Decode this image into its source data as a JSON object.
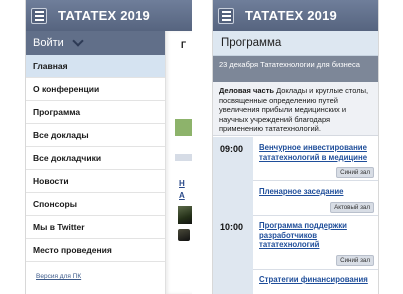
{
  "left": {
    "app_title": "ТАТАТЕХ 2019",
    "login_label": "Войти",
    "menu": [
      "Главная",
      "О конференции",
      "Программа",
      "Все доклады",
      "Все докладчики",
      "Новости",
      "Спонсоры",
      "Мы в Twitter",
      "Место проведения"
    ],
    "pc_link": "Версия для ПК",
    "peek": {
      "letter": "Г",
      "link1": "Н",
      "link2": "А"
    }
  },
  "right": {
    "app_title": "ТАТАТЕХ 2019",
    "section_title": "Программа",
    "date_line": "23 декабря Тататехнологии для бизнеса",
    "plenary_bold": "Деловая часть",
    "plenary_text": " Доклады и круглые столы, посвященные определению путей увеличения прибыли медицинских и научных учреждений благодаря применению тататехнологий.",
    "slots": [
      {
        "time": "09:00"
      },
      {
        "time": "10:00"
      }
    ],
    "events": [
      {
        "title": "Венчурное инвестирование тататехнологий в медицине",
        "room": "Синий зал"
      },
      {
        "title": "Пленарное заседание",
        "room": "Актовый зал"
      },
      {
        "title": "Программа поддержки разработчиков тататехнологий",
        "room": "Синий зал"
      },
      {
        "title": "Стратегии финансирования",
        "room": ""
      }
    ]
  },
  "icons": {
    "menu": "hamburger-icon",
    "login_toggle": "chevron-down-icon"
  },
  "colors": {
    "topbar": "#5e6c87",
    "login_bar": "#616f89",
    "active_item": "#d5e3f1",
    "date_bar": "#7d8798",
    "link": "#1f4e9a",
    "time_column": "#dfe7f0"
  }
}
